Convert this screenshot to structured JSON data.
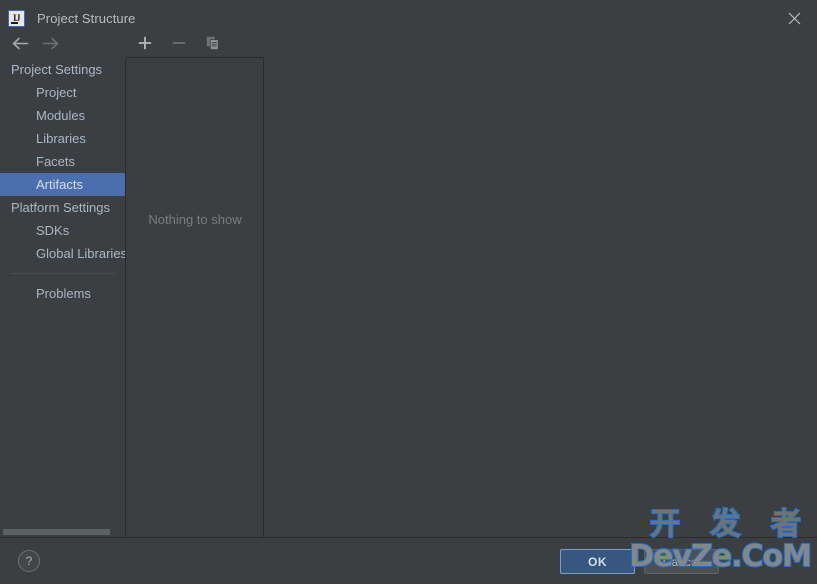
{
  "window": {
    "title": "Project Structure",
    "app_icon": "intellij-idea-icon",
    "close_icon": "close-icon"
  },
  "nav": {
    "back_icon": "arrow-left-icon",
    "forward_icon": "arrow-right-icon"
  },
  "toolbar": {
    "add_icon": "plus-icon",
    "remove_icon": "minus-icon",
    "copy_icon": "copy-icon"
  },
  "sidebar": {
    "items": [
      {
        "label": "Project Settings",
        "type": "group",
        "selected": false
      },
      {
        "label": "Project",
        "type": "child",
        "selected": false
      },
      {
        "label": "Modules",
        "type": "child",
        "selected": false
      },
      {
        "label": "Libraries",
        "type": "child",
        "selected": false
      },
      {
        "label": "Facets",
        "type": "child",
        "selected": false
      },
      {
        "label": "Artifacts",
        "type": "child",
        "selected": true
      },
      {
        "label": "Platform Settings",
        "type": "group",
        "selected": false
      },
      {
        "label": "SDKs",
        "type": "child",
        "selected": false
      },
      {
        "label": "Global Libraries",
        "type": "child",
        "selected": false
      }
    ],
    "footer_items": [
      {
        "label": "Problems",
        "type": "child",
        "selected": false
      }
    ]
  },
  "list_panel": {
    "empty_message": "Nothing to show"
  },
  "bottom": {
    "help_label": "?",
    "ok_label": "OK",
    "cancel_label": "Cancel"
  },
  "watermark": {
    "line1": "开 发 者",
    "line2": "DevZe.CoM"
  },
  "colors": {
    "background": "#3c3f41",
    "selection": "#4b6eaf",
    "text": "#a9b7c6",
    "muted_text": "#777c7f",
    "ok_button": "#365880",
    "ok_border": "#7a9ec7",
    "divider": "#2b2b2b",
    "watermark_outline": "#1f6fd0"
  }
}
